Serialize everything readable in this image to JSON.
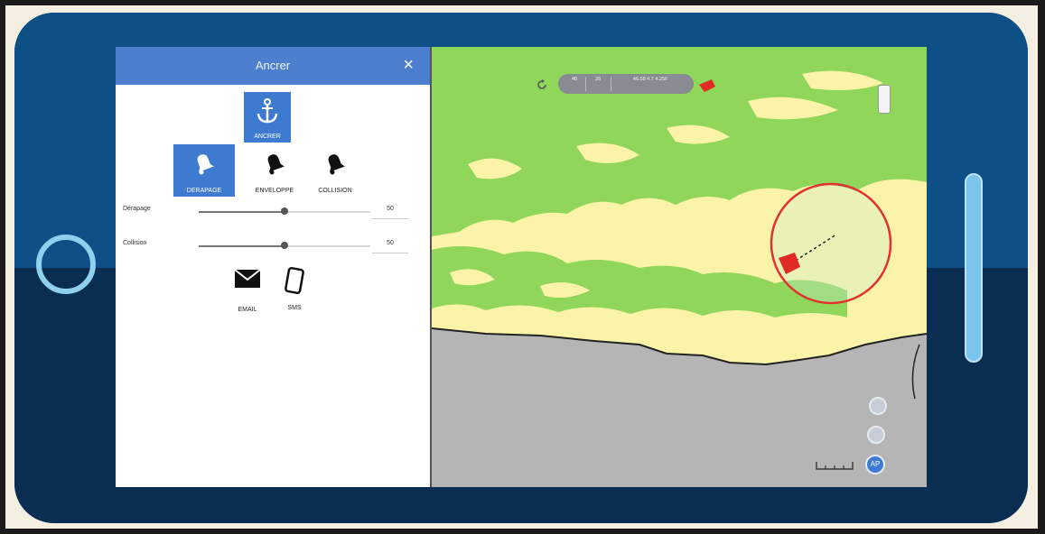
{
  "panel": {
    "title": "Ancrer",
    "close_glyph": "×",
    "modes": [
      {
        "label": "ANCRER",
        "icon": "anchor-icon",
        "active": true
      },
      {
        "label": "DERAPAGE",
        "icon": "bell-icon",
        "active": true
      },
      {
        "label": "ENVELOPPE",
        "icon": "bell-icon",
        "active": false
      },
      {
        "label": "COLLISION",
        "icon": "bell-icon",
        "active": false
      }
    ],
    "sliders": [
      {
        "label": "Dérapage",
        "value": "50",
        "level": 0.5
      },
      {
        "label": "Collision",
        "value": "50",
        "level": 0.5
      }
    ],
    "notify": [
      {
        "label": "EMAIL",
        "icon": "envelope-icon"
      },
      {
        "label": "SMS",
        "icon": "phone-icon"
      }
    ]
  },
  "map": {
    "info_pill": [
      "48",
      "28",
      "46.58 4.7 4.256",
      "",
      ""
    ],
    "ap_label": "AP",
    "colors": {
      "land": "#fbf4a8",
      "vegetation": "#8fd65a",
      "sea": "#b5b5b5",
      "circle": "#e0332f",
      "boat": "#e02a24",
      "accent": "#3d7bd4"
    }
  },
  "device": {
    "frame_top": "#0d4f86",
    "frame_bottom": "#0a2d52",
    "ring": "#8fd0ef"
  }
}
